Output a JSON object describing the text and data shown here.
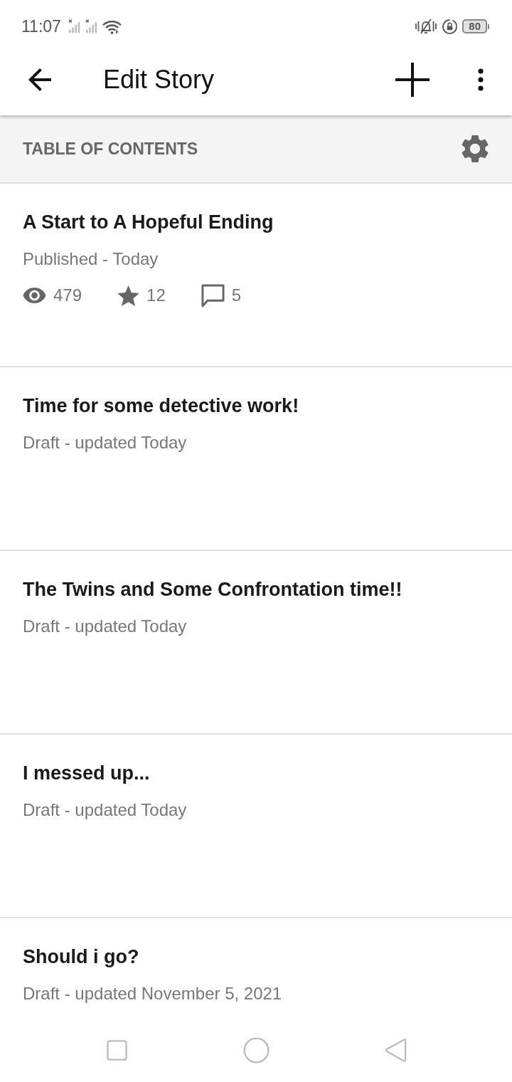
{
  "status_bar": {
    "time": "11:07",
    "battery": "80"
  },
  "app_bar": {
    "title": "Edit Story"
  },
  "section_header": {
    "title": "TABLE OF CONTENTS"
  },
  "parts": [
    {
      "title": "A Start to A Hopeful Ending",
      "status": "Published - Today",
      "stats": [
        {
          "kind": "views",
          "value": "479"
        },
        {
          "kind": "votes",
          "value": "12"
        },
        {
          "kind": "comments",
          "value": "5"
        }
      ]
    },
    {
      "title": "Time for some detective work!",
      "status": "Draft - updated Today"
    },
    {
      "title": "The Twins and Some Confrontation time!!",
      "status": "Draft - updated Today"
    },
    {
      "title": "I messed up...",
      "status": "Draft - updated Today"
    },
    {
      "title": "Should i go?",
      "status": "Draft - updated November 5, 2021"
    }
  ]
}
